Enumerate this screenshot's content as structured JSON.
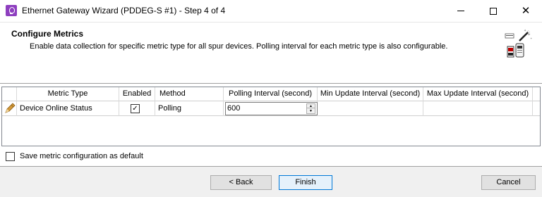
{
  "window": {
    "title": "Ethernet Gateway Wizard (PDDEG-S #1) - Step 4 of 4",
    "icon": "lightbulb-icon",
    "controls": [
      "minimize-icon",
      "maximize-icon",
      "close-icon"
    ]
  },
  "header": {
    "title": "Configure Metrics",
    "description": "Enable data collection for specific metric type for all spur devices. Polling interval for each metric type is also configurable.",
    "icon": "magic-wand-icon"
  },
  "grid": {
    "columns": [
      "Metric Type",
      "Enabled",
      "Method",
      "Polling Interval (second)",
      "Min Update Interval (second)",
      "Max Update Interval (second)"
    ],
    "rows": [
      {
        "row_icon": "pencil-icon",
        "metric_type": "Device Online Status",
        "enabled": true,
        "enabled_glyph": "✓",
        "method": "Polling",
        "polling_interval": "600",
        "min_update_interval": "",
        "max_update_interval": ""
      }
    ]
  },
  "options": {
    "save_default_label": "Save metric configuration as default",
    "save_default_checked": false
  },
  "footer": {
    "back_label": "< Back",
    "finish_label": "Finish",
    "cancel_label": "Cancel"
  },
  "colors": {
    "app_icon": "#8e3fbf",
    "footer_bg": "#f0f0f0",
    "focus_border": "#0078d7"
  }
}
